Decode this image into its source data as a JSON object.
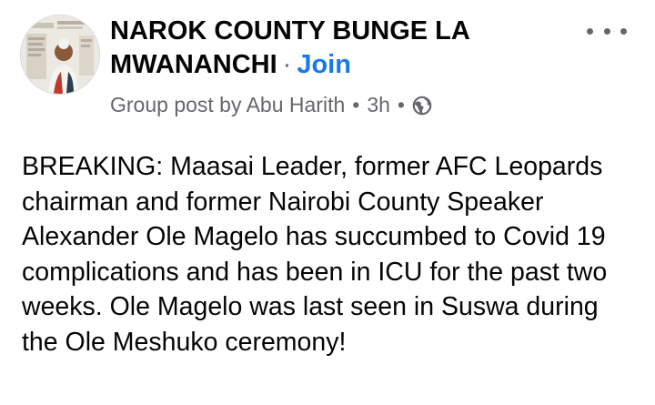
{
  "group": {
    "name": "NAROK COUNTY BUNGE LA MWANANCHI",
    "separator": "·",
    "join_label": "Join"
  },
  "meta": {
    "post_by": "Group post by Abu Harith",
    "bullet": "•",
    "time": "3h",
    "privacy_icon": "globe-icon"
  },
  "post": {
    "text": "BREAKING: Maasai Leader, former AFC Leopards chairman and former Nairobi County Speaker Alexander Ole Magelo has succumbed to Covid 19 complications and has been in ICU for the past two weeks. Ole Magelo was last seen in Suswa during the Ole Meshuko ceremony!"
  },
  "colors": {
    "link_blue": "#1877f2",
    "secondary_text": "#65676b",
    "primary_text": "#050505"
  },
  "icons": {
    "more": "more-options-icon",
    "avatar": "group-avatar"
  }
}
